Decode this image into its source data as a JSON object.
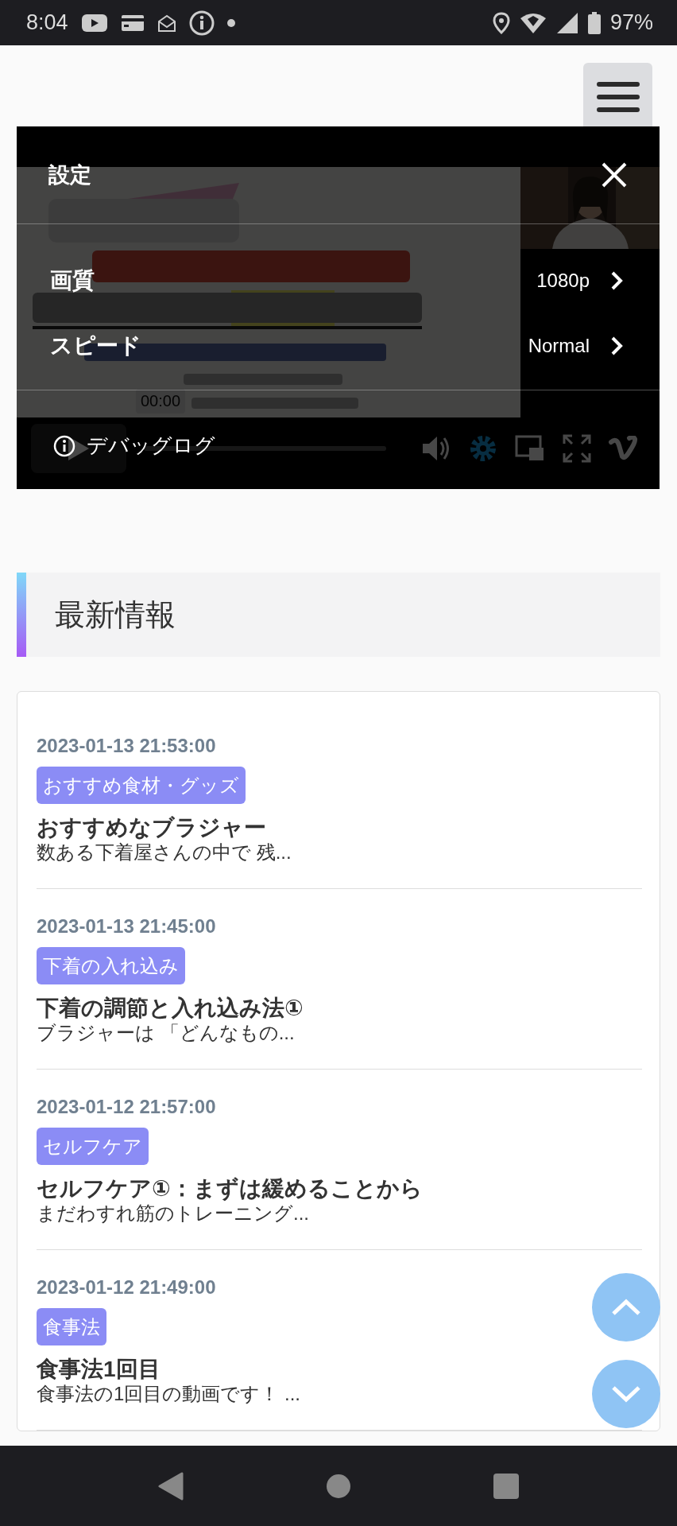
{
  "status_bar": {
    "time": "8:04",
    "battery": "97%"
  },
  "video_player": {
    "time": "00:00",
    "settings": {
      "title": "設定",
      "options": [
        {
          "label": "画質",
          "value": "1080p"
        },
        {
          "label": "スピード",
          "value": "Normal"
        }
      ],
      "debug_log": "デバッグログ"
    }
  },
  "section": {
    "title": "最新情報"
  },
  "posts": [
    {
      "date": "2023-01-13 21:53:00",
      "category": "おすすめ食材・グッズ",
      "title": "おすすめなブラジャー",
      "excerpt": "数ある下着屋さんの中で 残..."
    },
    {
      "date": "2023-01-13 21:45:00",
      "category": "下着の入れ込み",
      "title": "下着の調節と入れ込み法①",
      "excerpt": "ブラジャーは 「どんなもの..."
    },
    {
      "date": "2023-01-12 21:57:00",
      "category": "セルフケア",
      "title": "セルフケア①：まずは緩めることから",
      "excerpt": "まだわすれ筋のトレーニング..."
    },
    {
      "date": "2023-01-12 21:49:00",
      "category": "食事法",
      "title": "食事法1回目",
      "excerpt": "食事法の1回目の動画です！ ..."
    }
  ]
}
